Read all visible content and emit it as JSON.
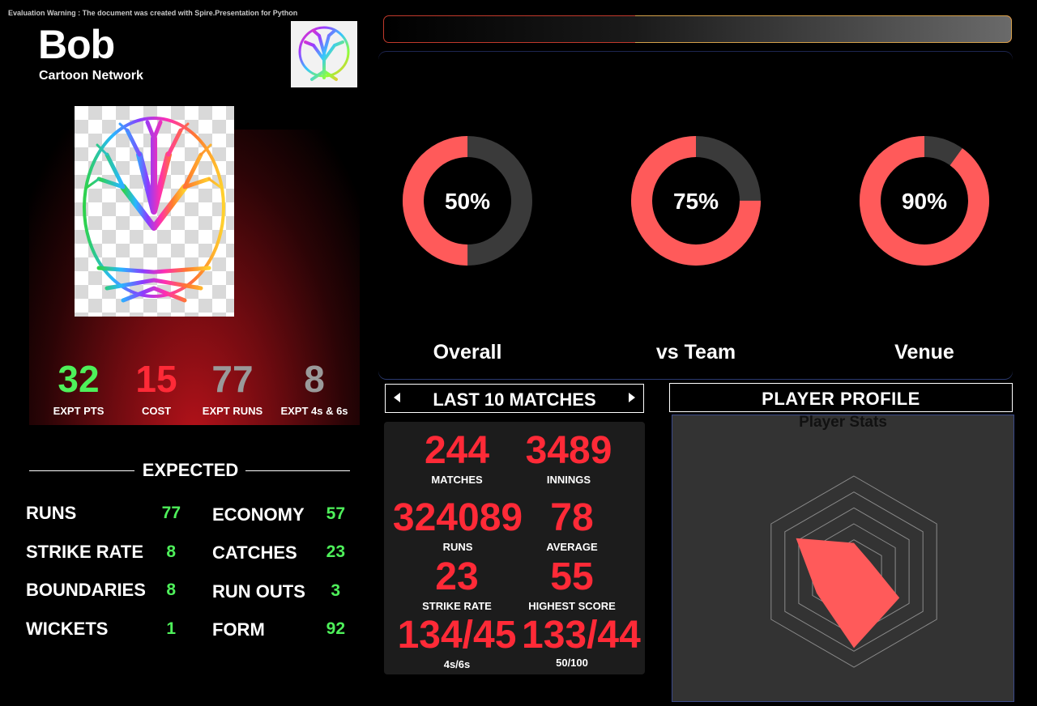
{
  "warning": "Evaluation Warning : The document was created with Spire.Presentation for Python",
  "player": {
    "name": "Bob",
    "team": "Cartoon Network"
  },
  "headline_stats": [
    {
      "value": "32",
      "label": "EXPT PTS",
      "color": "#4ef05a"
    },
    {
      "value": "15",
      "label": "COST",
      "color": "#ff2a37"
    },
    {
      "value": "77",
      "label": "EXPT RUNS",
      "color": "#9a9a9a"
    },
    {
      "value": "8",
      "label": "EXPT 4s & 6s",
      "color": "#9a9a9a"
    }
  ],
  "expected": {
    "title": "EXPECTED",
    "left": [
      {
        "label": "RUNS",
        "value": "77"
      },
      {
        "label": "STRIKE RATE",
        "value": "8"
      },
      {
        "label": "BOUNDARIES",
        "value": "8"
      },
      {
        "label": "WICKETS",
        "value": "1"
      }
    ],
    "right": [
      {
        "label": "ECONOMY",
        "value": "57"
      },
      {
        "label": "CATCHES",
        "value": "23"
      },
      {
        "label": "RUN OUTS",
        "value": "3"
      },
      {
        "label": "FORM",
        "value": "92"
      }
    ]
  },
  "donuts": [
    {
      "label": "Overall",
      "percent": 50,
      "text": "50%"
    },
    {
      "label": "vs Team",
      "percent": 75,
      "text": "75%"
    },
    {
      "label": "Venue",
      "percent": 90,
      "text": "90%"
    }
  ],
  "colors": {
    "accent_red": "#ff5a5a",
    "donut_track": "#3a3a3a",
    "stat_red": "#ff2a37",
    "stat_green": "#4ef05a"
  },
  "last10": {
    "title": "LAST 10 MATCHES",
    "stats": [
      {
        "value": "244",
        "label": "MATCHES"
      },
      {
        "value": "3489",
        "label": "INNINGS"
      },
      {
        "value": "324089",
        "label": "RUNS"
      },
      {
        "value": "78",
        "label": "AVERAGE"
      },
      {
        "value": "23",
        "label": "STRIKE RATE"
      },
      {
        "value": "55",
        "label": "HIGHEST SCORE"
      },
      {
        "value": "134/45",
        "label": "4s/6s"
      },
      {
        "value": "133/44",
        "label": "50/100"
      }
    ]
  },
  "profile": {
    "title": "PLAYER PROFILE"
  },
  "chart_data": {
    "type": "radar",
    "title": "Player Stats",
    "axes": 6,
    "max": 100,
    "series": [
      {
        "values": [
          30,
          20,
          55,
          80,
          45,
          70
        ]
      }
    ]
  }
}
